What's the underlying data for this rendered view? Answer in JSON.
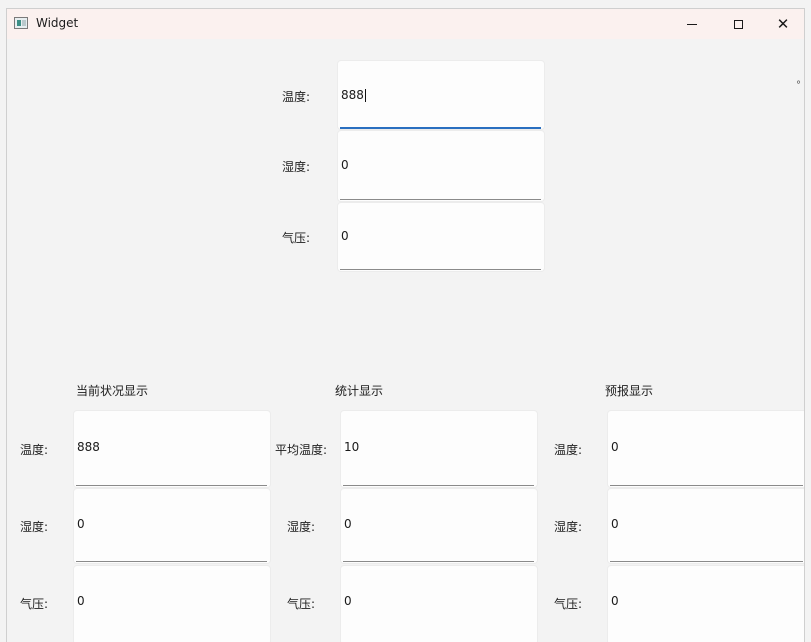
{
  "window": {
    "title": "Widget"
  },
  "input": {
    "temperature": {
      "label": "温度:",
      "value": "888"
    },
    "humidity": {
      "label": "湿度:",
      "value": "0"
    },
    "pressure": {
      "label": "气压:",
      "value": "0"
    }
  },
  "current": {
    "title": "当前状况显示",
    "temperature": {
      "label": "温度:",
      "value": "888"
    },
    "humidity": {
      "label": "湿度:",
      "value": "0"
    },
    "pressure": {
      "label": "气压:",
      "value": "0"
    }
  },
  "stats": {
    "title": "统计显示",
    "avg_temperature": {
      "label": "平均温度:",
      "value": "10"
    },
    "humidity": {
      "label": "湿度:",
      "value": "0"
    },
    "pressure": {
      "label": "气压:",
      "value": "0"
    }
  },
  "forecast": {
    "title": "预报显示",
    "temperature": {
      "label": "温度:",
      "value": "0"
    },
    "humidity": {
      "label": "湿度:",
      "value": "0"
    },
    "pressure": {
      "label": "气压:",
      "value": "0"
    }
  },
  "stray_mark": "°"
}
